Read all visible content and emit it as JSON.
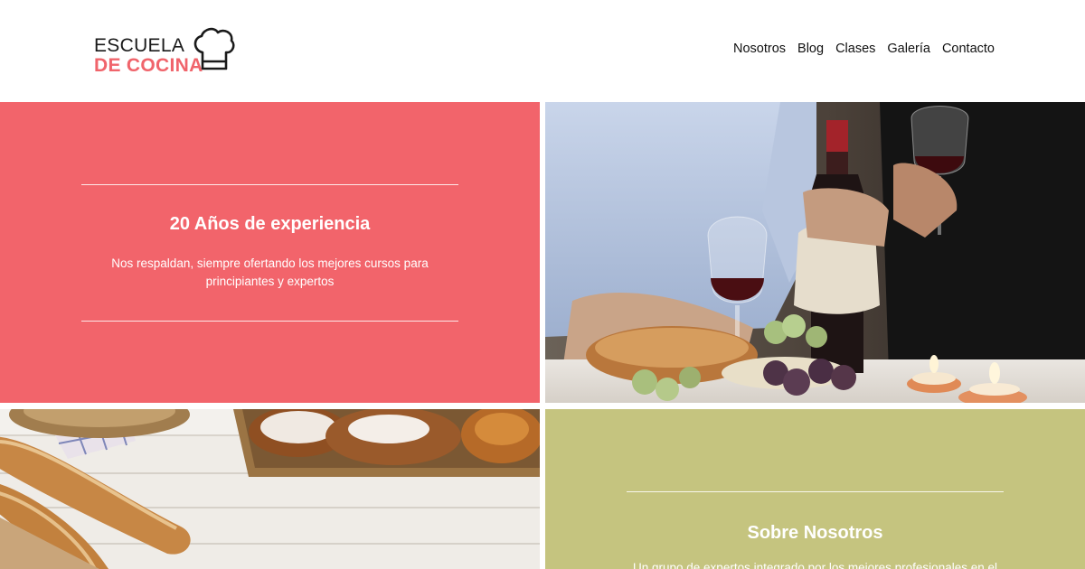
{
  "header": {
    "logo": {
      "line1": "ESCUELA",
      "line2": "DE COCINA"
    },
    "nav": [
      {
        "label": "Nosotros"
      },
      {
        "label": "Blog"
      },
      {
        "label": "Clases"
      },
      {
        "label": "Galería"
      },
      {
        "label": "Contacto"
      }
    ]
  },
  "experience": {
    "title": "20 Años de experiencia",
    "text": "Nos respaldan, siempre ofertando los mejores cursos para principiantes y expertos"
  },
  "about": {
    "title": "Sobre Nosotros",
    "text": "Un grupo de expertos integrado por los mejores profesionales en el"
  },
  "colors": {
    "brand_red": "#f2646b",
    "green_tile": "#c5c47f",
    "text_dark": "#111111"
  },
  "icons": {
    "logo": "chef-hat-icon"
  }
}
